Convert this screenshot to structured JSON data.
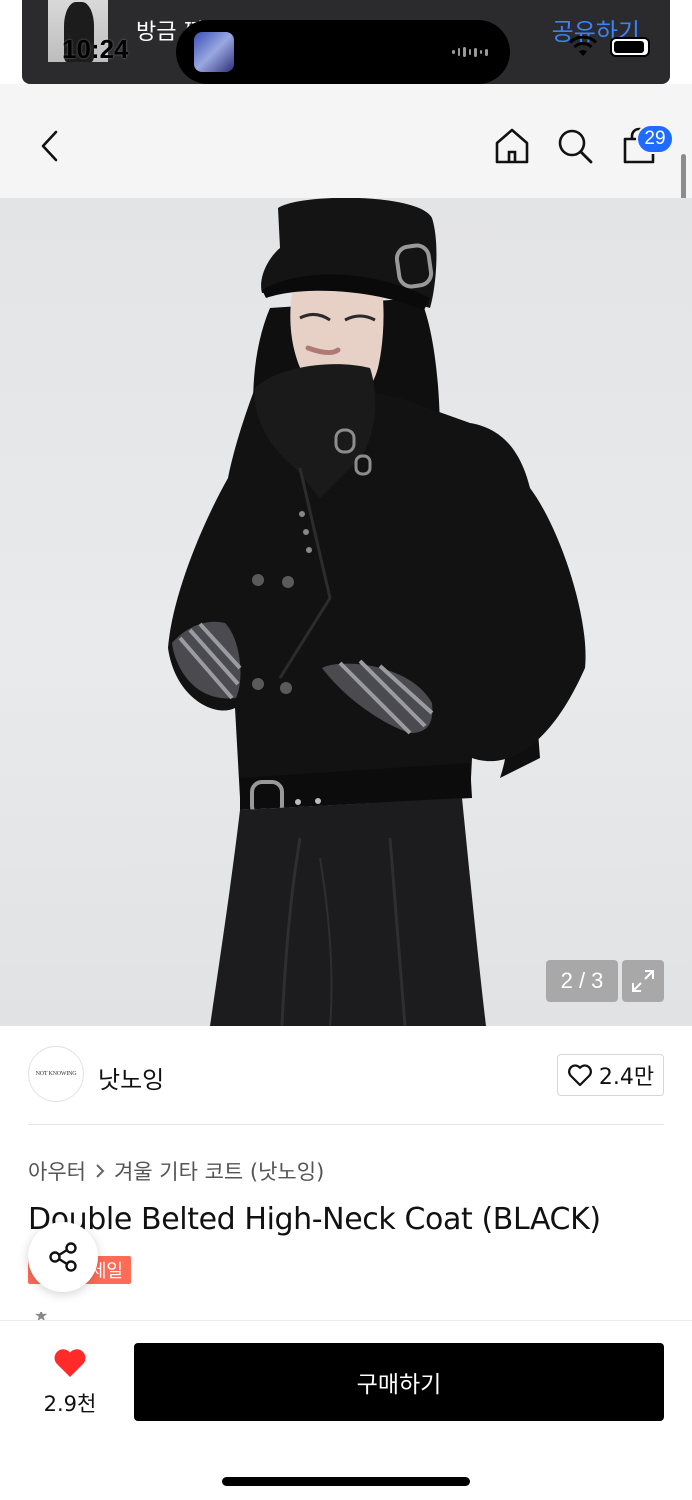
{
  "status_bar": {
    "time": "10:24"
  },
  "toast": {
    "message": "방금 찜을 하셨어요 공유해보세요!",
    "action_label": "공유하기"
  },
  "header": {
    "cart_count": "29"
  },
  "image": {
    "counter": "2 / 3"
  },
  "brand": {
    "logo_text": "NOT KNOWING",
    "name": "낫노잉",
    "like_count": "2.4만"
  },
  "breadcrumb": {
    "category": "아우터",
    "subcategory": "겨울 기타 코트 (낫노잉)"
  },
  "product": {
    "title": "Double Belted High-Neck Coat (BLACK)",
    "badge": "세일"
  },
  "bottom_bar": {
    "wish_count": "2.9천",
    "buy_label": "구매하기"
  },
  "colors": {
    "accent_blue": "#1f6bff",
    "sale_badge": "#ff6b57",
    "heart": "#ff2b2b",
    "buy_button": "#000000"
  }
}
